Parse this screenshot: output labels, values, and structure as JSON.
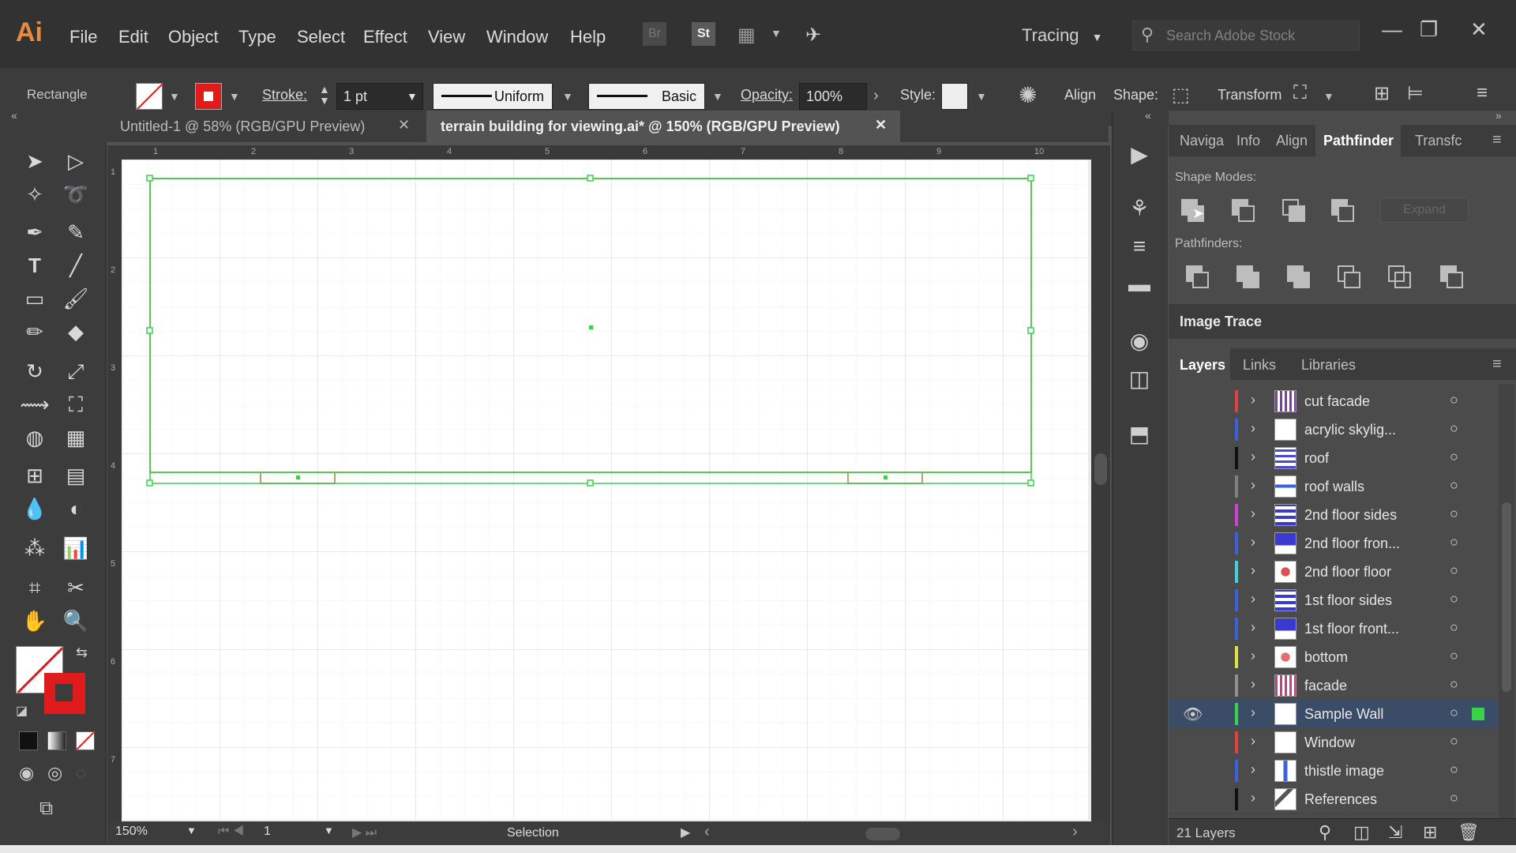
{
  "app": {
    "logo": "Ai"
  },
  "menu": [
    "File",
    "Edit",
    "Object",
    "Type",
    "Select",
    "Effect",
    "View",
    "Window",
    "Help"
  ],
  "header": {
    "bridge_label": "Br",
    "stock_label": "St",
    "workspace": "Tracing",
    "stock_search_placeholder": "Search Adobe Stock"
  },
  "control_bar": {
    "tool_name": "Rectangle",
    "stroke_label": "Stroke:",
    "stroke_value": "1 pt",
    "profile": "Uniform",
    "brush": "Basic",
    "opacity_label": "Opacity:",
    "opacity_value": "100%",
    "style_label": "Style:",
    "align_label": "Align",
    "shape_label": "Shape:",
    "transform_label": "Transform",
    "stroke_color": "#e01b1b"
  },
  "tabs": [
    {
      "label": "Untitled-1 @ 58% (RGB/GPU Preview)",
      "active": false
    },
    {
      "label": "terrain building for viewing.ai* @ 150% (RGB/GPU Preview)",
      "active": true
    }
  ],
  "rulers": {
    "top": [
      "1",
      "2",
      "3",
      "4",
      "5",
      "6",
      "7",
      "8",
      "9",
      "10"
    ],
    "left": [
      "1",
      "2",
      "3",
      "4",
      "5",
      "6",
      "7"
    ]
  },
  "status": {
    "zoom": "150%",
    "page": "1",
    "status_text": "Selection"
  },
  "panels": {
    "top_tabs": [
      "Naviga",
      "Info",
      "Align",
      "Pathfinder",
      "Transfc"
    ],
    "active_tab": "Pathfinder",
    "shape_modes_label": "Shape Modes:",
    "expand_label": "Expand",
    "pathfinders_label": "Pathfinders:",
    "image_trace_label": "Image Trace",
    "layers_tabs": [
      "Layers",
      "Links",
      "Libraries"
    ],
    "layers": [
      {
        "name": "cut facade",
        "color": "#e04040",
        "selected": false
      },
      {
        "name": "acrylic skylig...",
        "color": "#3a62e0",
        "selected": false
      },
      {
        "name": "roof",
        "color": "#111111",
        "selected": false
      },
      {
        "name": "roof walls",
        "color": "#808080",
        "selected": false
      },
      {
        "name": "2nd floor sides",
        "color": "#d040d0",
        "selected": false
      },
      {
        "name": "2nd floor fron...",
        "color": "#3a62e0",
        "selected": false
      },
      {
        "name": "2nd floor floor",
        "color": "#40d0e0",
        "selected": false
      },
      {
        "name": "1st floor sides",
        "color": "#3a62e0",
        "selected": false
      },
      {
        "name": "1st floor front...",
        "color": "#3a62e0",
        "selected": false
      },
      {
        "name": "bottom",
        "color": "#e0e040",
        "selected": false
      },
      {
        "name": "facade",
        "color": "#909090",
        "selected": false
      },
      {
        "name": "Sample Wall",
        "color": "#39d34a",
        "selected": true
      },
      {
        "name": "Window",
        "color": "#e04040",
        "selected": false
      },
      {
        "name": "thistle image",
        "color": "#3a62e0",
        "selected": false
      },
      {
        "name": "References",
        "color": "#111111",
        "selected": false
      }
    ],
    "layers_count": "21 Layers"
  },
  "colors": {
    "selection": "#39d34a",
    "artwork_stroke": "#b4a46a",
    "accent": "#e01b1b"
  }
}
